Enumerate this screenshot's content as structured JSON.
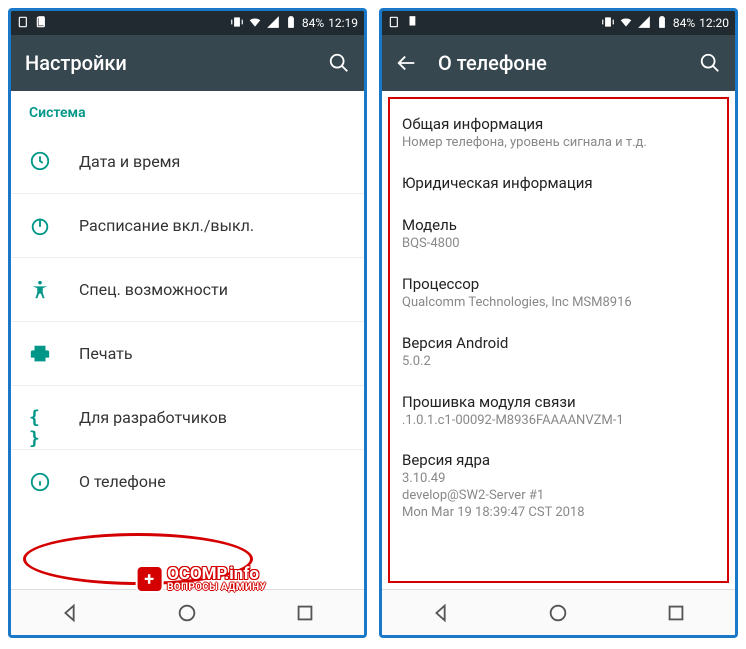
{
  "left": {
    "status": {
      "battery": "84%",
      "time": "12:19"
    },
    "appbar": {
      "title": "Настройки"
    },
    "section": "Система",
    "items": [
      {
        "label": "Дата и время"
      },
      {
        "label": "Расписание вкл./выкл."
      },
      {
        "label": "Спец. возможности"
      },
      {
        "label": "Печать"
      },
      {
        "label": "Для разработчиков"
      },
      {
        "label": "О телефоне"
      }
    ]
  },
  "right": {
    "status": {
      "battery": "84%",
      "time": "12:20"
    },
    "appbar": {
      "title": "О телефоне"
    },
    "details": [
      {
        "title": "Общая информация",
        "sub": "Номер телефона, уровень сигнала и т.д."
      },
      {
        "title": "Юридическая информация",
        "sub": ""
      },
      {
        "title": "Модель",
        "sub": "BQS-4800"
      },
      {
        "title": "Процессор",
        "sub": "Qualcomm Technologies, Inc MSM8916"
      },
      {
        "title": "Версия Android",
        "sub": "5.0.2"
      },
      {
        "title": "Прошивка модуля связи",
        "sub": ".1.0.1.c1-00092-M8936FAAAANVZM-1"
      },
      {
        "title": "Версия ядра",
        "sub": "3.10.49\ndevelop@SW2-Server #1\nMon Mar 19 18:39:47 CST 2018"
      }
    ]
  },
  "watermark": {
    "main": "OCOMP.info",
    "sub": "ВОПРОСЫ АДМИНУ"
  }
}
